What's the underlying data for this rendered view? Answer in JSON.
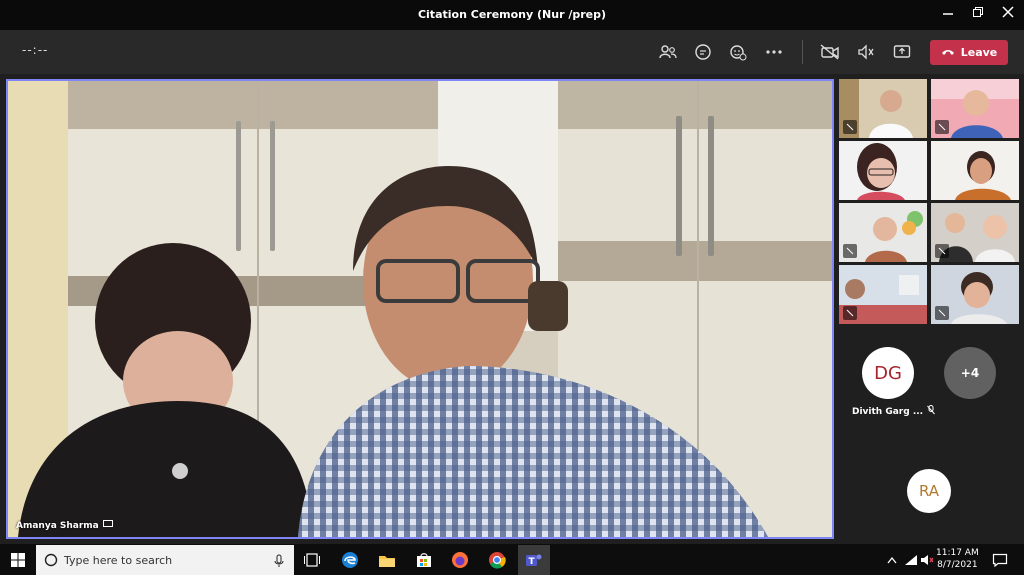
{
  "window": {
    "title": "Citation Ceremony (Nur /prep)"
  },
  "toolbar": {
    "timer": "--:--",
    "leave_label": "Leave"
  },
  "colors": {
    "accent": "#7f85f5",
    "leave": "#c4314b",
    "avatar_dg_text": "#a4262c"
  },
  "main_video": {
    "participant_name": "Amanya Sharma"
  },
  "sidebar": {
    "overflow_participant": {
      "initials": "DG",
      "name": "Divith Garg ..."
    },
    "more_count": "+4",
    "audio_only": {
      "initials": "RA"
    }
  },
  "taskbar": {
    "search_placeholder": "Type here to search",
    "time": "11:17 AM",
    "date": "8/7/2021"
  }
}
